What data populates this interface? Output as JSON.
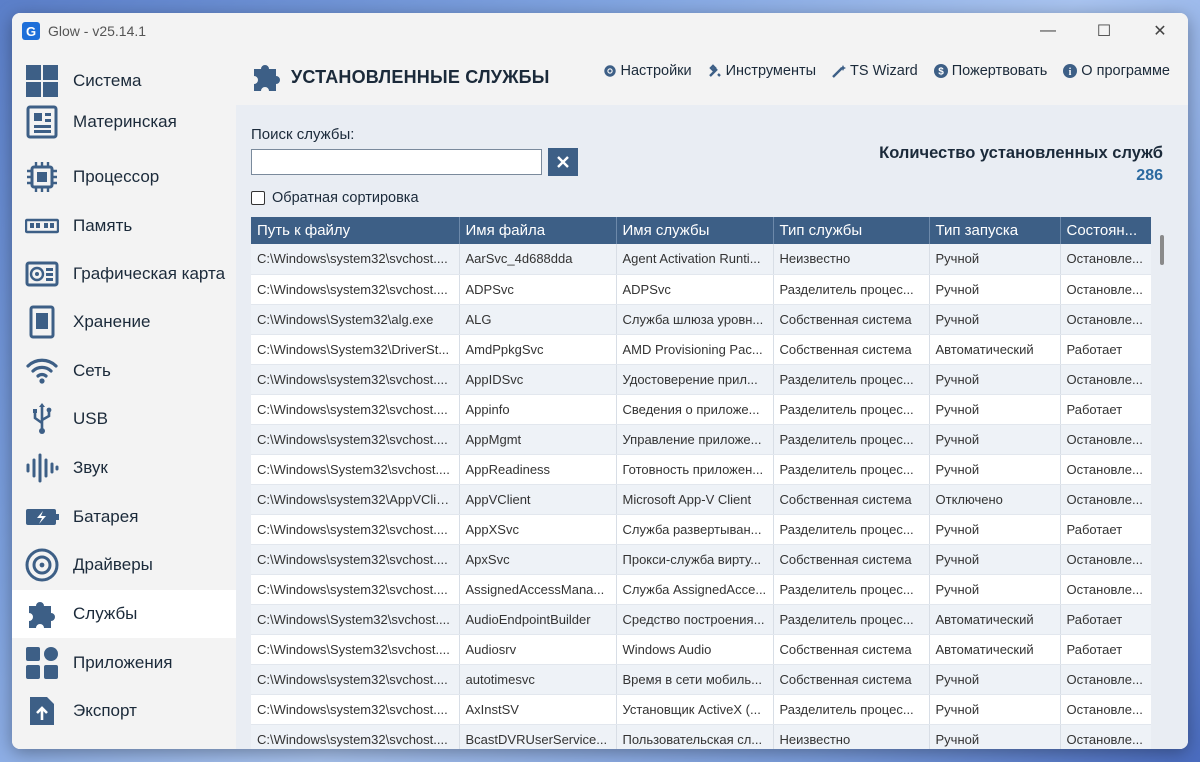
{
  "window": {
    "logo": "G",
    "title": "Glow - v25.14.1",
    "controls": {
      "minimize": "—",
      "maximize": "☐",
      "close": "✕"
    }
  },
  "sidebar": {
    "items": [
      {
        "label": "Система",
        "icon": "windows-grid-icon",
        "active": false
      },
      {
        "label": "Материнская",
        "icon": "motherboard-icon",
        "active": false
      },
      {
        "label": "Процессор",
        "icon": "cpu-icon",
        "active": false
      },
      {
        "label": "Память",
        "icon": "ram-icon",
        "active": false
      },
      {
        "label": "Графическая карта",
        "icon": "gpu-icon",
        "active": false
      },
      {
        "label": "Хранение",
        "icon": "storage-icon",
        "active": false
      },
      {
        "label": "Сеть",
        "icon": "wifi-icon",
        "active": false
      },
      {
        "label": "USB",
        "icon": "usb-icon",
        "active": false
      },
      {
        "label": "Звук",
        "icon": "sound-icon",
        "active": false
      },
      {
        "label": "Батарея",
        "icon": "battery-icon",
        "active": false
      },
      {
        "label": "Драйверы",
        "icon": "drivers-icon",
        "active": false
      },
      {
        "label": "Службы",
        "icon": "puzzle-icon",
        "active": true
      },
      {
        "label": "Приложения",
        "icon": "apps-icon",
        "active": false
      },
      {
        "label": "Экспорт",
        "icon": "export-icon",
        "active": false
      }
    ]
  },
  "header": {
    "title": "УСТАНОВЛЕННЫЕ СЛУЖБЫ",
    "menu": {
      "settings": "Настройки",
      "tools": "Инструменты",
      "ts_wizard": "TS Wizard",
      "donate": "Пожертвовать",
      "about": "О программе"
    }
  },
  "search": {
    "label": "Поиск службы:",
    "value": "",
    "placeholder": "",
    "reverse_sort_label": "Обратная сортировка",
    "reverse_sort_checked": false
  },
  "summary": {
    "count_label": "Количество установленных служб",
    "count_value": "286"
  },
  "table": {
    "headers": [
      "Путь к файлу",
      "Имя файла",
      "Имя службы",
      "Тип службы",
      "Тип запуска",
      "Состоян..."
    ],
    "rows": [
      [
        "C:\\Windows\\system32\\svchost....",
        "AarSvc_4d688dda",
        "Agent Activation Runti...",
        "Неизвестно",
        "Ручной",
        "Остановле..."
      ],
      [
        "C:\\Windows\\system32\\svchost....",
        "ADPSvc",
        "ADPSvc",
        "Разделитель процес...",
        "Ручной",
        "Остановле..."
      ],
      [
        "C:\\Windows\\System32\\alg.exe",
        "ALG",
        "Служба шлюза уровн...",
        "Собственная система",
        "Ручной",
        "Остановле..."
      ],
      [
        "C:\\Windows\\System32\\DriverSt...",
        "AmdPpkgSvc",
        "AMD Provisioning Pac...",
        "Собственная система",
        "Автоматический",
        "Работает"
      ],
      [
        "C:\\Windows\\system32\\svchost....",
        "AppIDSvc",
        "Удостоверение прил...",
        "Разделитель процес...",
        "Ручной",
        "Остановле..."
      ],
      [
        "C:\\Windows\\system32\\svchost....",
        "Appinfo",
        "Сведения о приложе...",
        "Разделитель процес...",
        "Ручной",
        "Работает"
      ],
      [
        "C:\\Windows\\system32\\svchost....",
        "AppMgmt",
        "Управление приложе...",
        "Разделитель процес...",
        "Ручной",
        "Остановле..."
      ],
      [
        "C:\\Windows\\System32\\svchost....",
        "AppReadiness",
        "Готовность приложен...",
        "Разделитель процес...",
        "Ручной",
        "Остановле..."
      ],
      [
        "C:\\Windows\\system32\\AppVClie...",
        "AppVClient",
        "Microsoft App-V Client",
        "Собственная система",
        "Отключено",
        "Остановле..."
      ],
      [
        "C:\\Windows\\system32\\svchost....",
        "AppXSvc",
        "Служба развертыван...",
        "Разделитель процес...",
        "Ручной",
        "Работает"
      ],
      [
        "C:\\Windows\\system32\\svchost....",
        "ApxSvc",
        "Прокси-служба вирту...",
        "Собственная система",
        "Ручной",
        "Остановле..."
      ],
      [
        "C:\\Windows\\system32\\svchost....",
        "AssignedAccessMana...",
        "Служба AssignedAcce...",
        "Разделитель процес...",
        "Ручной",
        "Остановле..."
      ],
      [
        "C:\\Windows\\System32\\svchost....",
        "AudioEndpointBuilder",
        "Средство построения...",
        "Разделитель процес...",
        "Автоматический",
        "Работает"
      ],
      [
        "C:\\Windows\\System32\\svchost....",
        "Audiosrv",
        "Windows Audio",
        "Собственная система",
        "Автоматический",
        "Работает"
      ],
      [
        "C:\\Windows\\system32\\svchost....",
        "autotimesvc",
        "Время в сети мобиль...",
        "Собственная система",
        "Ручной",
        "Остановле..."
      ],
      [
        "C:\\Windows\\system32\\svchost....",
        "AxInstSV",
        "Установщик ActiveX (...",
        "Разделитель процес...",
        "Ручной",
        "Остановле..."
      ],
      [
        "C:\\Windows\\system32\\svchost....",
        "BcastDVRUserService...",
        "Пользовательская сл...",
        "Неизвестно",
        "Ручной",
        "Остановле..."
      ]
    ]
  },
  "colors": {
    "accent": "#3d5f86",
    "active_bg": "#ffffff",
    "count_value": "#2c6aa0"
  }
}
